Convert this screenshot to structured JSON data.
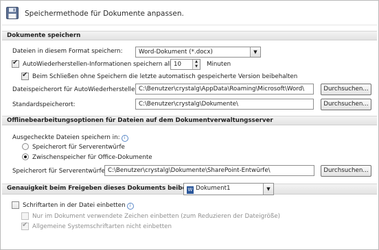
{
  "header": {
    "title": "Speichermethode für Dokumente anpassen."
  },
  "save_section": {
    "title": "Dokumente speichern",
    "format_label": "Dateien in diesem Format speichern:",
    "format_value": "Word-Dokument (*.docx)",
    "autosave_label": "AutoWiederherstellen-Informationen speichern alle",
    "autosave_checked": true,
    "autosave_minutes": "10",
    "minutes_label": "Minuten",
    "keep_last_label": "Beim Schließen ohne Speichern die letzte automatisch gespeicherte Version beibehalten",
    "keep_last_checked": true,
    "autorecover_path_label": "Dateispeicherort für AutoWiederherstellen:",
    "autorecover_path_value": "C:\\Benutzer\\crystalg\\AppData\\Roaming\\Microsoft\\Word\\",
    "default_path_label": "Standardspeicherort:",
    "default_path_value": "C:\\Benutzer\\crystalg\\Dokumente\\",
    "browse_label": "Durchsuchen..."
  },
  "offline_section": {
    "title": "Offlinebearbeitungsoptionen für Dateien auf dem Dokumentverwaltungsserver",
    "checked_out_label": "Ausgecheckte Dateien speichern in:",
    "radio_server_drafts": "Speicherort für Serverentwürfe",
    "radio_office_cache": "Zwischenspeicher für Office-Dokumente",
    "selected": "office_cache",
    "drafts_path_label": "Speicherort für Serverentwürfe:",
    "drafts_path_value": "C:\\Benutzer\\crystalg\\Dokumente\\SharePoint-Entwürfe\\",
    "browse_label": "Durchsuchen..."
  },
  "fidelity_section": {
    "title": "Genauigkeit beim Freigeben dieses Dokuments beibehalten:",
    "document_value": "Dokument1",
    "embed_fonts_label": "Schriftarten in der Datei einbetten",
    "embed_fonts_checked": false,
    "embed_used_chars_label": "Nur im Dokument verwendete Zeichen einbetten (zum Reduzieren der Dateigröße)",
    "embed_used_chars_checked": false,
    "no_system_fonts_label": "Allgemeine Systemschriftarten nicht einbetten",
    "no_system_fonts_checked": true
  },
  "icons": {
    "header": "floppy-disk-icon",
    "info": "info-icon",
    "doc": "word-document-icon",
    "dropdown": "chevron-down-icon"
  }
}
